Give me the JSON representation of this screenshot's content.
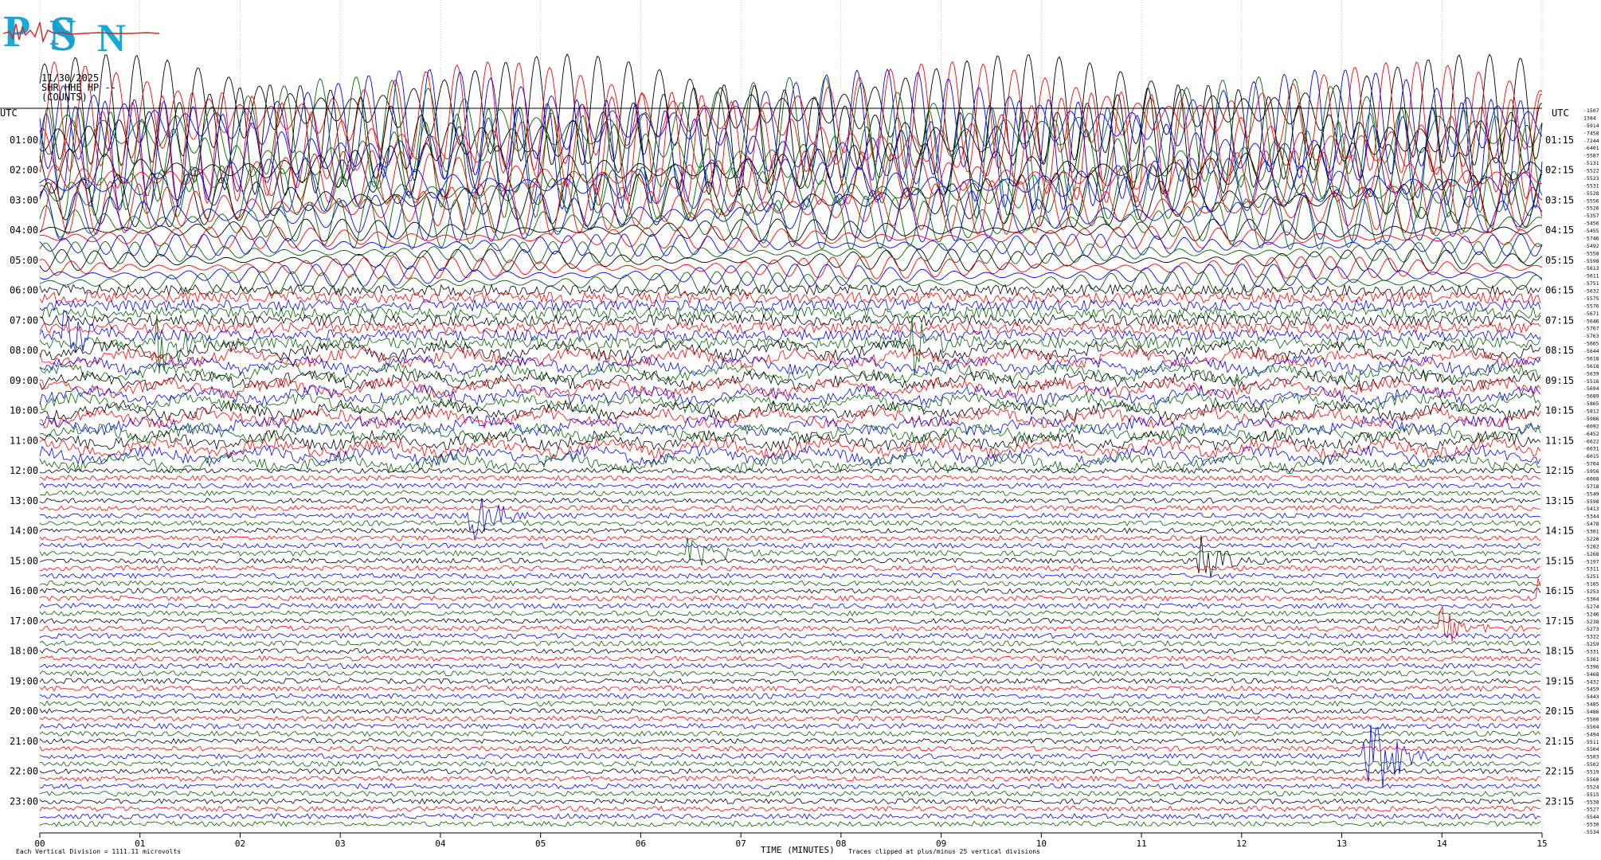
{
  "logo": {
    "text": "PNSN"
  },
  "header": {
    "date": "11/30/2025",
    "station": "SHR HHE HP --",
    "units": "(COUNTS)"
  },
  "footer": {
    "scale": "Each Vertical Division = 1111.11 microvolts",
    "xlabel": "TIME (MINUTES)",
    "clip": "Traces clipped at plus/minus 25 vertical divisions"
  },
  "colors": {
    "black": "#000000",
    "red": "#ff0000",
    "blue": "#0000ff",
    "green": "#006400",
    "grid": "#9a9a9a"
  },
  "chart_data": {
    "type": "line",
    "title": "SHR HHE HP --",
    "xlabel": "TIME (MINUTES)",
    "ylabel": "UTC",
    "xlim": [
      0,
      15
    ],
    "x_ticks": [
      "00",
      "01",
      "02",
      "03",
      "04",
      "05",
      "06",
      "07",
      "08",
      "09",
      "10",
      "11",
      "12",
      "13",
      "14",
      "15"
    ],
    "left_axis_title": "UTC",
    "right_axis_title": "UTC",
    "left_ticks": [
      "01:00",
      "02:00",
      "03:00",
      "04:00",
      "05:00",
      "06:00",
      "07:00",
      "08:00",
      "09:00",
      "10:00",
      "11:00",
      "12:00",
      "13:00",
      "14:00",
      "15:00",
      "16:00",
      "17:00",
      "18:00",
      "19:00",
      "20:00",
      "21:00",
      "22:00",
      "23:00"
    ],
    "right_ticks": [
      "01:15",
      "02:15",
      "03:15",
      "04:15",
      "05:15",
      "06:15",
      "07:15",
      "08:15",
      "09:15",
      "10:15",
      "11:15",
      "12:15",
      "13:15",
      "14:15",
      "15:15",
      "16:15",
      "17:15",
      "18:15",
      "19:15",
      "20:15",
      "21:15",
      "22:15",
      "23:15"
    ],
    "trace_colors": [
      "black",
      "red",
      "blue",
      "green"
    ],
    "trace_count": 96,
    "trace_offsets": [
      "-1507",
      "1384",
      "-5914",
      "-7458",
      "-7244",
      "-6401",
      "-5587",
      "-5131",
      "-5522",
      "-5523",
      "-5531",
      "-5528",
      "-5556",
      "-5526",
      "-5357",
      "-5456",
      "-5455",
      "-5746",
      "-5492",
      "-5558",
      "-5598",
      "-5613",
      "-5611",
      "-5751",
      "-5632",
      "-5575",
      "-5576",
      "-5671",
      "-5646",
      "-5767",
      "-5763",
      "-5665",
      "-5644",
      "-5618",
      "-5618",
      "-5639",
      "-5516",
      "-5694",
      "-5689",
      "-5865",
      "-5812",
      "-5986",
      "-6092",
      "-6452",
      "-6622",
      "-6631",
      "-6015",
      "-5704",
      "-5956",
      "-6008",
      "-5718",
      "-5549",
      "-5598",
      "-5413",
      "-5344",
      "-5478",
      "-5301",
      "-5220",
      "-5282",
      "-5268",
      "-5197",
      "-5311",
      "-5251",
      "-5165",
      "-5253",
      "-5304",
      "-5274",
      "-5246",
      "-5238",
      "-5273",
      "-5322",
      "-5259",
      "-5331",
      "-5361",
      "-5396",
      "-5468",
      "-5432",
      "-5459",
      "-5443",
      "-5485",
      "-5486",
      "-5500",
      "-5504",
      "-5494",
      "-5511",
      "-5504",
      "-5503",
      "-5502",
      "-5519",
      "-5560",
      "-5524",
      "-5515",
      "-5538",
      "-5527",
      "-5544",
      "-5530",
      "-5534"
    ],
    "events": [
      {
        "trace": 30,
        "minute": 0.25,
        "amplitude": 40,
        "color": "blue"
      },
      {
        "trace": 31,
        "minute": 1.2,
        "amplitude": 45,
        "color": "green"
      },
      {
        "trace": 31,
        "minute": 8.75,
        "amplitude": 40,
        "color": "blue"
      },
      {
        "trace": 54,
        "minute": 4.3,
        "amplitude": 45,
        "color": "blue"
      },
      {
        "trace": 59,
        "minute": 6.5,
        "amplitude": 25,
        "color": "green"
      },
      {
        "trace": 60,
        "minute": 11.6,
        "amplitude": 30,
        "color": "black"
      },
      {
        "trace": 65,
        "minute": 15.0,
        "amplitude": 30,
        "color": "red"
      },
      {
        "trace": 69,
        "minute": 14.0,
        "amplitude": 25,
        "color": "red"
      },
      {
        "trace": 86,
        "minute": 13.25,
        "amplitude": 90,
        "color": "blue"
      }
    ]
  }
}
